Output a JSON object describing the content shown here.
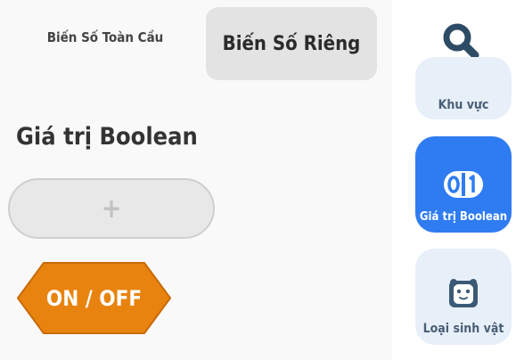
{
  "tabs": {
    "global_label": "Biến Số Toàn Cầu",
    "private_label": "Biến Số Riêng"
  },
  "section": {
    "title": "Giá trị Boolean"
  },
  "add_button": {
    "label": "+"
  },
  "variable_block": {
    "label": "ON / OFF",
    "color": "#e8830f"
  },
  "sidebar": {
    "search_icon": "search-icon",
    "categories": [
      {
        "label": "Khu vực",
        "icon": "region-icon",
        "selected": false
      },
      {
        "label": "Giá trị Boolean",
        "icon": "boolean-icon",
        "selected": true
      },
      {
        "label": "Loại sinh vật",
        "icon": "creature-icon",
        "selected": false
      }
    ]
  },
  "colors": {
    "accent_blue": "#2f7cf2",
    "category_bg": "#e7eff9",
    "search_icon": "#2d4b64",
    "block_orange": "#e8830f"
  }
}
